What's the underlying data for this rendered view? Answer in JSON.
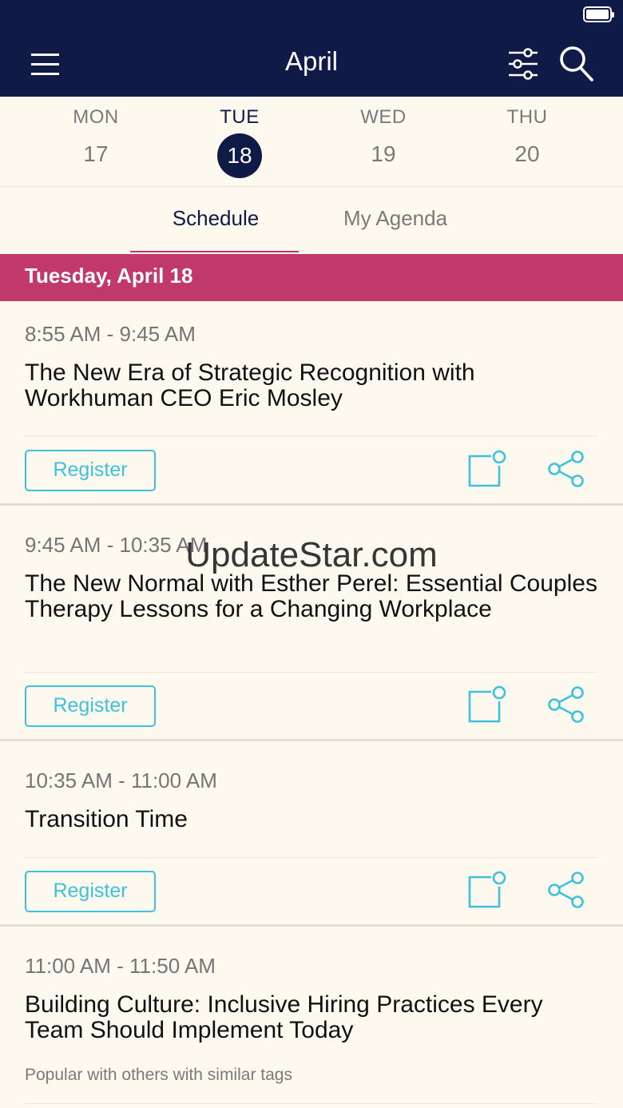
{
  "header": {
    "title": "April",
    "icons": {
      "menu": "menu-icon",
      "filter": "filter-icon",
      "search": "search-icon"
    }
  },
  "days": [
    {
      "name": "MON",
      "num": "17",
      "active": false
    },
    {
      "name": "TUE",
      "num": "18",
      "active": true
    },
    {
      "name": "WED",
      "num": "19",
      "active": false
    },
    {
      "name": "THU",
      "num": "20",
      "active": false
    }
  ],
  "tabs": {
    "schedule": "Schedule",
    "agenda": "My Agenda"
  },
  "date_header": "Tuesday, April 18",
  "sessions": [
    {
      "time": "8:55 AM - 9:45 AM",
      "title": "The New Era of Strategic Recognition with Workhuman CEO Eric Mosley",
      "register_label": "Register"
    },
    {
      "time": "9:45 AM - 10:35 AM",
      "title": "The New Normal with Esther Perel: Essential Couples Therapy Lessons for a Changing Workplace",
      "register_label": "Register"
    },
    {
      "time": "10:35 AM - 11:00 AM",
      "title": "Transition Time",
      "register_label": "Register"
    },
    {
      "time": "11:00 AM - 11:50 AM",
      "title": "Building Culture: Inclusive Hiring Practices Every Team Should Implement Today",
      "note": "Popular with others with similar tags"
    }
  ],
  "watermark": "UpdateStar.com",
  "colors": {
    "navy": "#0f1a47",
    "accent_pink": "#c1396b",
    "action_cyan": "#3ec1dc",
    "background": "#fdf9ef"
  }
}
